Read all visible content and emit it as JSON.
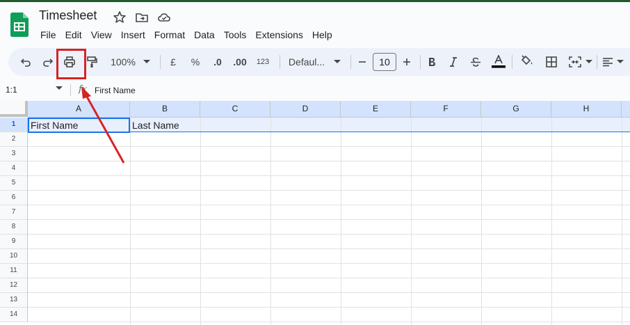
{
  "app": {
    "title": "Timesheet",
    "icons": [
      "sheets-logo-icon",
      "star-icon",
      "move-to-folder-icon",
      "cloud-saved-icon"
    ]
  },
  "menu": [
    "File",
    "Edit",
    "View",
    "Insert",
    "Format",
    "Data",
    "Tools",
    "Extensions",
    "Help"
  ],
  "toolbar": {
    "zoom": "100%",
    "currency": "£",
    "percent": "%",
    "decrease_decimal": ".0",
    "increase_decimal": ".00",
    "number_format": "123",
    "font": "Defaul...",
    "font_size": "10",
    "icons": [
      "undo-icon",
      "redo-icon",
      "print-icon",
      "paint-format-icon",
      "bold-icon",
      "italic-icon",
      "strikethrough-icon",
      "text-color-icon",
      "fill-color-icon",
      "borders-icon",
      "merge-cells-icon",
      "align-icon"
    ]
  },
  "formula_bar": {
    "name_box": "1:1",
    "fx": "fx",
    "value": "First Name"
  },
  "grid": {
    "columns": [
      "A",
      "B",
      "C",
      "D",
      "E",
      "F",
      "G",
      "H"
    ],
    "rows": [
      "1",
      "2",
      "3",
      "4",
      "5",
      "6",
      "7",
      "8",
      "9",
      "10",
      "11",
      "12",
      "13",
      "14"
    ],
    "cells": {
      "A1": "First Name",
      "B1": "Last Name"
    }
  },
  "colors": {
    "accent": "#1a73e8",
    "annotation": "#d62424",
    "toolbar_bg": "#edf2fa",
    "header_selected": "#d3e3fd"
  }
}
